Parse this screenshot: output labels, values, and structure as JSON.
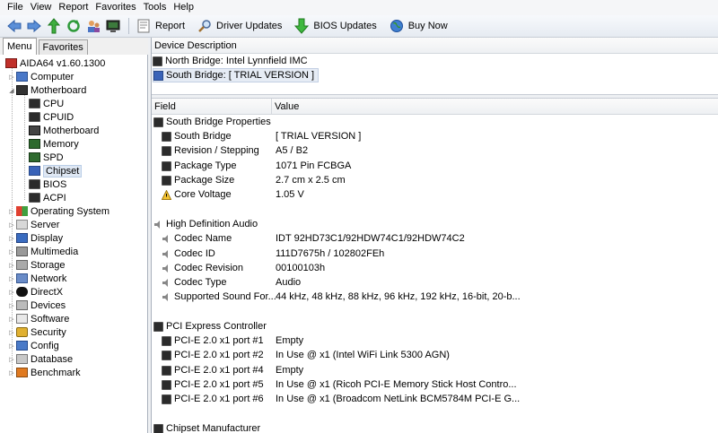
{
  "menu": [
    "File",
    "View",
    "Report",
    "Favorites",
    "Tools",
    "Help"
  ],
  "toolbar": {
    "report_label": "Report",
    "driver_updates_label": "Driver Updates",
    "bios_updates_label": "BIOS Updates",
    "buy_now_label": "Buy Now"
  },
  "tabs": {
    "menu": "Menu",
    "favorites": "Favorites"
  },
  "tree": {
    "root": "AIDA64 v1.60.1300",
    "computer": "Computer",
    "motherboard": "Motherboard",
    "children": [
      "CPU",
      "CPUID",
      "Motherboard",
      "Memory",
      "SPD",
      "Chipset",
      "BIOS",
      "ACPI"
    ],
    "others": [
      "Operating System",
      "Server",
      "Display",
      "Multimedia",
      "Storage",
      "Network",
      "DirectX",
      "Devices",
      "Software",
      "Security",
      "Config",
      "Database",
      "Benchmark"
    ]
  },
  "device_header": "Device Description",
  "devices": [
    "North Bridge: Intel Lynnfield IMC",
    "South Bridge: [ TRIAL VERSION ]"
  ],
  "columns": {
    "field": "Field",
    "value": "Value"
  },
  "groups": {
    "south_bridge": {
      "title": "South Bridge Properties",
      "rows": [
        {
          "field": "South Bridge",
          "value": "[ TRIAL VERSION ]"
        },
        {
          "field": "Revision / Stepping",
          "value": "A5 / B2"
        },
        {
          "field": "Package Type",
          "value": "1071 Pin FCBGA"
        },
        {
          "field": "Package Size",
          "value": "2.7 cm x 2.5 cm"
        },
        {
          "field": "Core Voltage",
          "value": "1.05 V"
        }
      ]
    },
    "audio": {
      "title": "High Definition Audio",
      "rows": [
        {
          "field": "Codec Name",
          "value": "IDT 92HD73C1/92HDW74C1/92HDW74C2"
        },
        {
          "field": "Codec ID",
          "value": "111D7675h / 102802FEh"
        },
        {
          "field": "Codec Revision",
          "value": "00100103h"
        },
        {
          "field": "Codec Type",
          "value": "Audio"
        },
        {
          "field": "Supported Sound For...",
          "value": "44 kHz, 48 kHz, 88 kHz, 96 kHz, 192 kHz, 16-bit, 20-b..."
        }
      ]
    },
    "pcie": {
      "title": "PCI Express Controller",
      "rows": [
        {
          "field": "PCI-E 2.0 x1 port #1",
          "value": "Empty"
        },
        {
          "field": "PCI-E 2.0 x1 port #2",
          "value": "In Use @ x1  (Intel WiFi Link 5300 AGN)"
        },
        {
          "field": "PCI-E 2.0 x1 port #4",
          "value": "Empty"
        },
        {
          "field": "PCI-E 2.0 x1 port #5",
          "value": "In Use @ x1  (Ricoh PCI-E Memory Stick Host Contro..."
        },
        {
          "field": "PCI-E 2.0 x1 port #6",
          "value": "In Use @ x1  (Broadcom NetLink BCM5784M PCI-E G..."
        }
      ]
    },
    "chipset_manufacturer": {
      "title": "Chipset Manufacturer"
    }
  }
}
